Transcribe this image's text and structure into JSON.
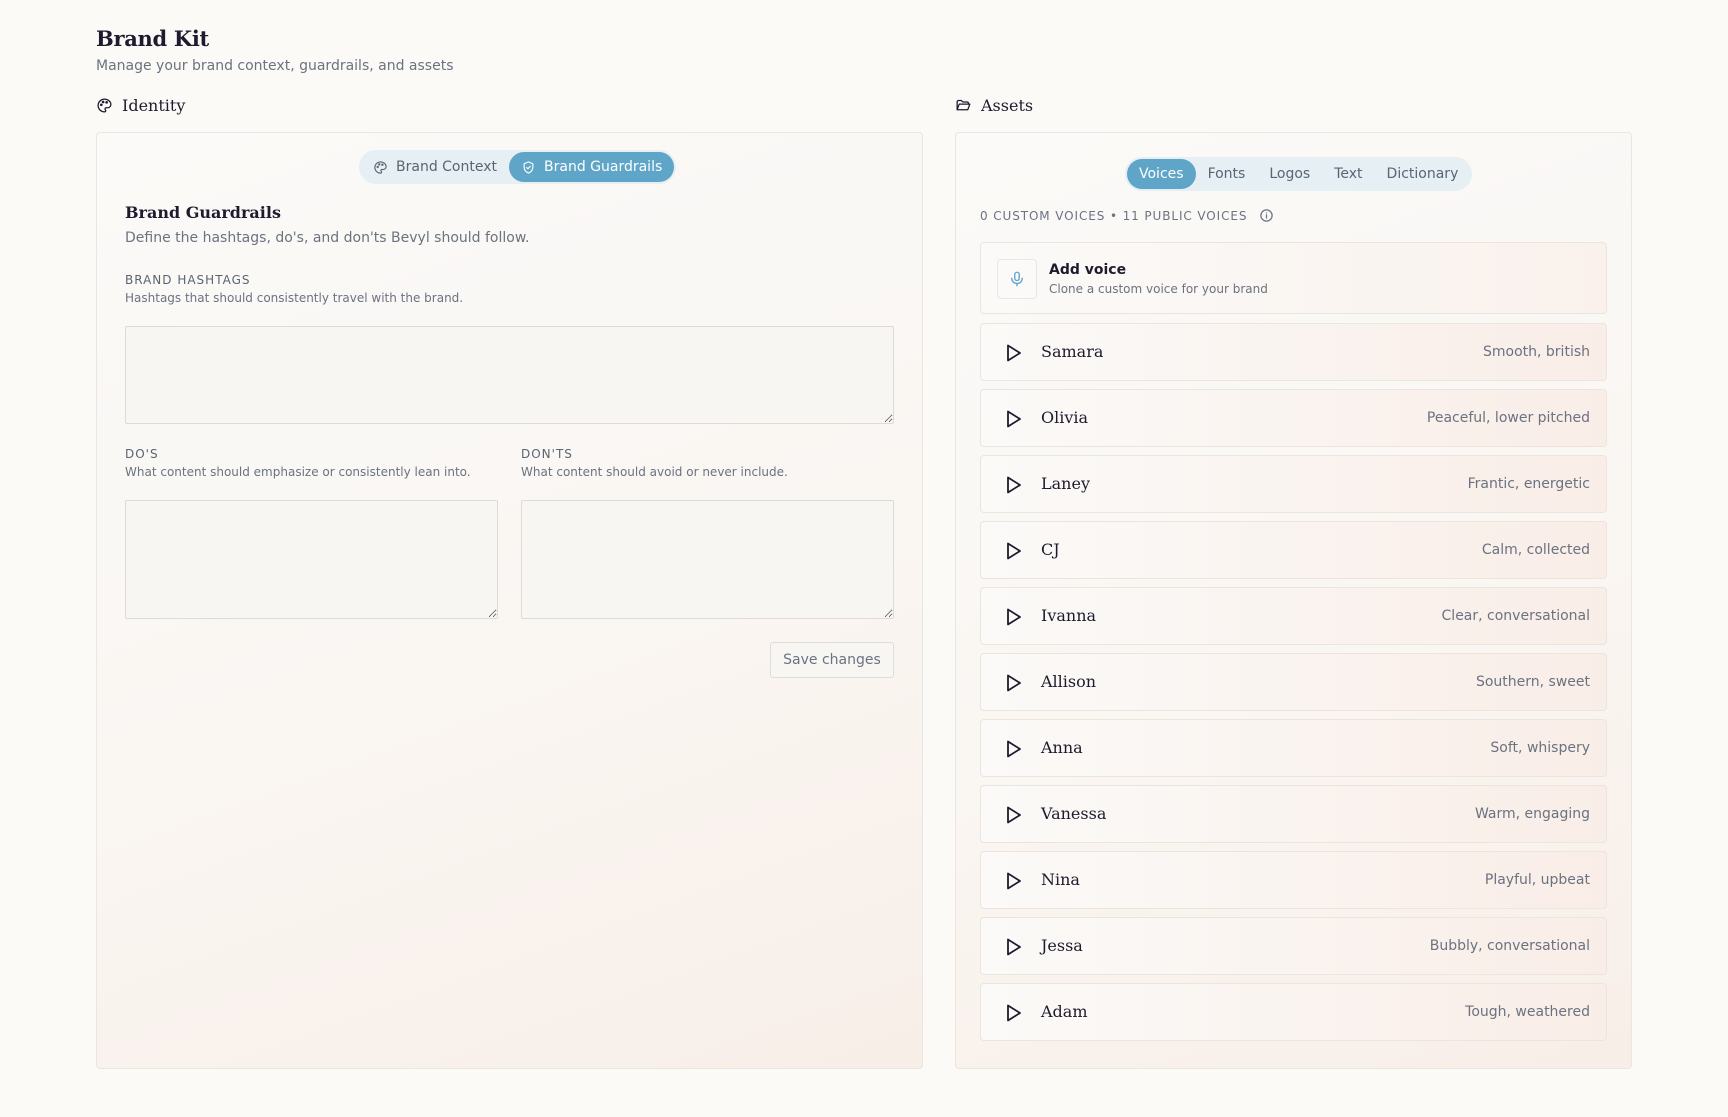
{
  "header": {
    "title": "Brand Kit",
    "subtitle": "Manage your brand context, guardrails, and assets"
  },
  "identity": {
    "section_title": "Identity",
    "section_icon": "palette-icon",
    "toggle": [
      {
        "label": "Brand Context",
        "icon": "palette-icon",
        "active": false
      },
      {
        "label": "Brand Guardrails",
        "icon": "shield-check-icon",
        "active": true
      }
    ],
    "card": {
      "title": "Brand Guardrails",
      "description": "Define the hashtags, do's, and don'ts Bevyl should follow."
    },
    "hashtags": {
      "label": "BRAND HASHTAGS",
      "help": "Hashtags that should consistently travel with the brand.",
      "value": ""
    },
    "dos": {
      "label": "DO'S",
      "help": "What content should emphasize or consistently lean into.",
      "value": ""
    },
    "donts": {
      "label": "DON'TS",
      "help": "What content should avoid or never include.",
      "value": ""
    },
    "save_label": "Save changes"
  },
  "assets": {
    "section_title": "Assets",
    "section_icon": "folder-open-icon",
    "tabs": [
      {
        "label": "Voices",
        "active": true
      },
      {
        "label": "Fonts",
        "active": false
      },
      {
        "label": "Logos",
        "active": false
      },
      {
        "label": "Text",
        "active": false
      },
      {
        "label": "Dictionary",
        "active": false
      }
    ],
    "voices_count": "0 CUSTOM VOICES • 11 PUBLIC VOICES",
    "add_voice": {
      "title": "Add voice",
      "subtitle": "Clone a custom voice for your brand",
      "icon": "microphone-icon"
    },
    "voices": [
      {
        "name": "Samara",
        "description": "Smooth, british"
      },
      {
        "name": "Olivia",
        "description": "Peaceful, lower pitched"
      },
      {
        "name": "Laney",
        "description": "Frantic, energetic"
      },
      {
        "name": "CJ",
        "description": "Calm, collected"
      },
      {
        "name": "Ivanna",
        "description": "Clear, conversational"
      },
      {
        "name": "Allison",
        "description": "Southern, sweet"
      },
      {
        "name": "Anna",
        "description": "Soft, whispery"
      },
      {
        "name": "Vanessa",
        "description": "Warm, engaging"
      },
      {
        "name": "Nina",
        "description": "Playful, upbeat"
      },
      {
        "name": "Jessa",
        "description": "Bubbly, conversational"
      },
      {
        "name": "Adam",
        "description": "Tough, weathered"
      }
    ]
  },
  "colors": {
    "accent": "#5fa5c8",
    "toggle_bg": "#e6eff3",
    "background": "#fcfaf7"
  }
}
